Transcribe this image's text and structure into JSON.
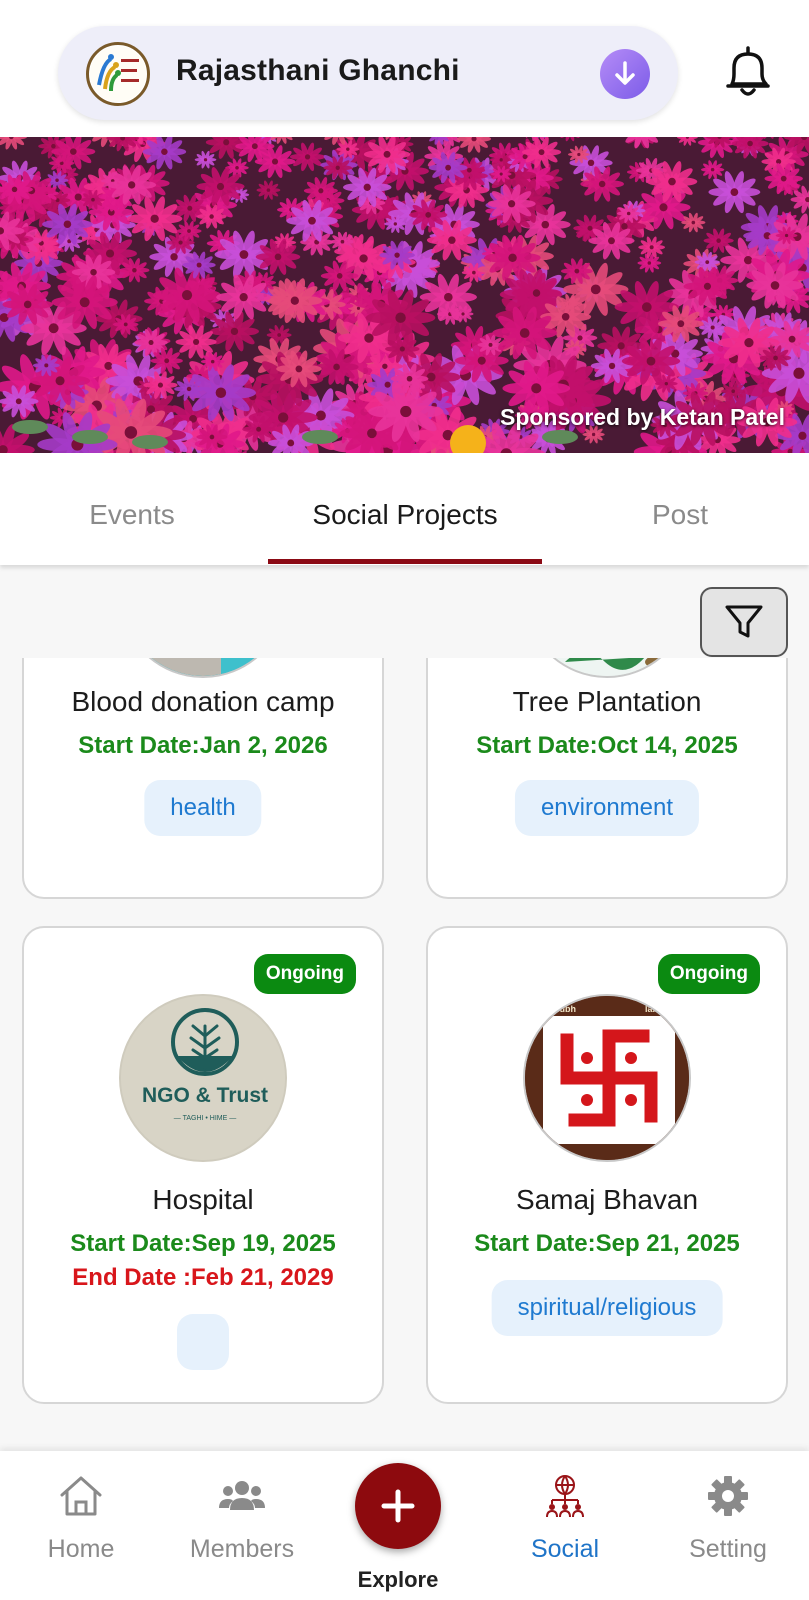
{
  "header": {
    "app_title": "Rajasthani Ghanchi",
    "logo_icon": "community-logo-icon",
    "download_icon": "download-arrow-icon",
    "notification_icon": "bell-icon"
  },
  "banner": {
    "sponsor_text": "Sponsored by Ketan Patel"
  },
  "tabs": [
    {
      "label": "Events",
      "active": false
    },
    {
      "label": "Social Projects",
      "active": true
    },
    {
      "label": "Post",
      "active": false
    }
  ],
  "filter": {
    "icon": "filter-funnel-icon"
  },
  "projects": [
    {
      "title": "Blood donation camp",
      "start_date": "Start Date:Jan 2, 2026",
      "tag": "health"
    },
    {
      "title": "Tree Plantation",
      "start_date": "Start Date:Oct 14, 2025",
      "tag": "environment"
    },
    {
      "title": "Hospital",
      "status": "Ongoing",
      "start_date": "Start Date:Sep 19, 2025",
      "end_date": "End Date :Feb 21, 2029",
      "tag": "",
      "image_text": "NGO & Trust",
      "image_subtext": "— TAGHI • HIME —"
    },
    {
      "title": "Samaj Bhavan",
      "status": "Ongoing",
      "start_date": "Start Date:Sep 21, 2025",
      "tag": "spiritual/religious",
      "image_top_left": "shubh",
      "image_top_right": "labh"
    }
  ],
  "bottom_nav": [
    {
      "label": "Home",
      "icon": "home-icon",
      "active": false
    },
    {
      "label": "Members",
      "icon": "members-icon",
      "active": false
    },
    {
      "label": "Explore",
      "icon": "plus-icon",
      "active": false
    },
    {
      "label": "Social",
      "icon": "social-network-icon",
      "active": true
    },
    {
      "label": "Setting",
      "icon": "gear-icon",
      "active": false
    }
  ],
  "colors": {
    "accent": "#8b0a14",
    "status_green": "#0b8a11",
    "start_date_green": "#1b8a1b",
    "end_date_red": "#d8161b",
    "tag_blue": "#1f7ad0",
    "active_nav_blue": "#1f74c8"
  }
}
